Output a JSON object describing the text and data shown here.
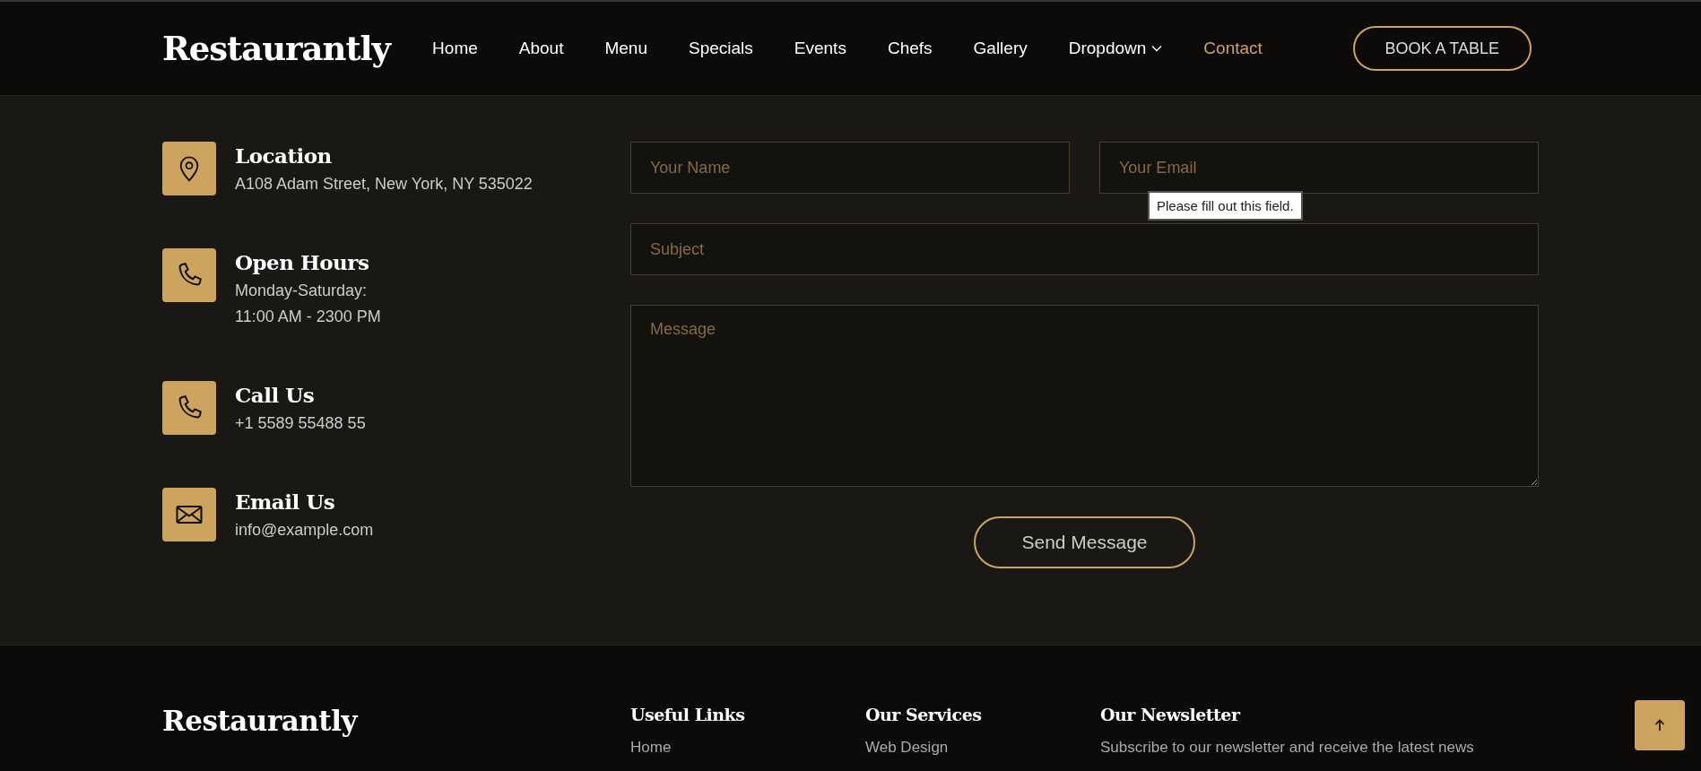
{
  "header": {
    "logo": "Restaurantly",
    "nav": [
      {
        "label": "Home",
        "kind": "link",
        "selected": false
      },
      {
        "label": "About",
        "kind": "link",
        "selected": false
      },
      {
        "label": "Menu",
        "kind": "link",
        "selected": false
      },
      {
        "label": "Specials",
        "kind": "link",
        "selected": false
      },
      {
        "label": "Events",
        "kind": "link",
        "selected": false
      },
      {
        "label": "Chefs",
        "kind": "link",
        "selected": false
      },
      {
        "label": "Gallery",
        "kind": "link",
        "selected": false
      },
      {
        "label": "Dropdown",
        "kind": "dropdown",
        "selected": false
      },
      {
        "label": "Contact",
        "kind": "link",
        "selected": true
      }
    ],
    "button": "BOOK A TABLE"
  },
  "contact_info": [
    {
      "kind": "pin",
      "title": "Location",
      "lines": [
        "A108 Adam Street, New York, NY 535022"
      ]
    },
    {
      "kind": "phone",
      "title": "Open Hours",
      "lines": [
        "Monday-Saturday:",
        "11:00 AM - 2300 PM"
      ]
    },
    {
      "kind": "phone",
      "title": "Call Us",
      "lines": [
        "+1 5589 55488 55"
      ]
    },
    {
      "kind": "mail",
      "title": "Email Us",
      "lines": [
        "info@example.com"
      ]
    }
  ],
  "form": {
    "name": {
      "placeholder": "Your Name"
    },
    "email": {
      "placeholder": "Your Email",
      "validation_message": "Please fill out this field."
    },
    "subject": {
      "placeholder": "Subject"
    },
    "message": {
      "placeholder": "Message"
    },
    "submit": "Send Message"
  },
  "footer": {
    "logo": "Restaurantly",
    "columns": [
      {
        "title": "Useful Links",
        "items": [
          "Home"
        ]
      },
      {
        "title": "Our Services",
        "items": [
          "Web Design"
        ]
      },
      {
        "title": "Our Newsletter",
        "items": [
          "Subscribe to our newsletter and receive the latest news"
        ]
      }
    ]
  }
}
